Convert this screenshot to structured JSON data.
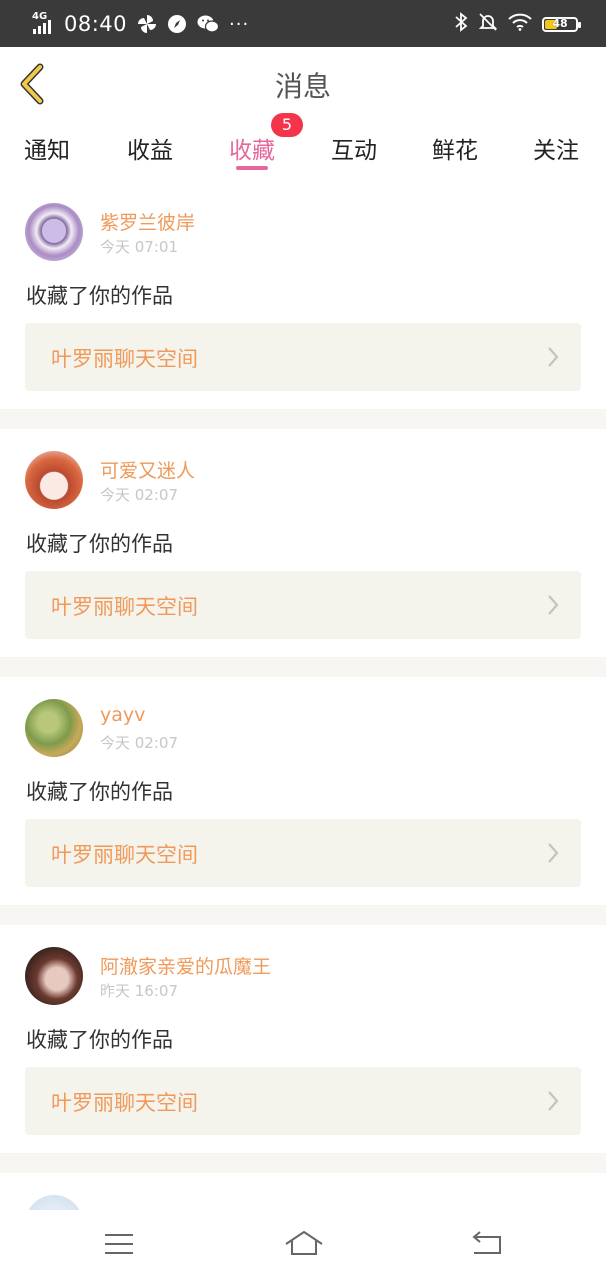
{
  "status_bar": {
    "network": "4G",
    "time": "08:40",
    "battery": "48",
    "battery_level": 0.48,
    "icons": [
      "signal-icon",
      "pinwheel-icon",
      "compass-icon",
      "wechat-icon",
      "more-dots-icon",
      "bluetooth-icon",
      "bell-muted-icon",
      "wifi-icon",
      "battery-icon"
    ]
  },
  "header": {
    "title": "消息",
    "back_icon": "chevron-left-icon"
  },
  "tabs": [
    {
      "label": "通知"
    },
    {
      "label": "收益"
    },
    {
      "label": "收藏",
      "active": true,
      "badge": "5"
    },
    {
      "label": "互动"
    },
    {
      "label": "鲜花"
    },
    {
      "label": "关注"
    }
  ],
  "colors": {
    "accent": "#e8679a",
    "username": "#ef9a5a",
    "badge": "#f3344a",
    "work_box": "#f4f4ed"
  },
  "messages": [
    {
      "username": "紫罗兰彼岸",
      "time": "今天 07:01",
      "action": "收藏了你的作品",
      "work": "叶罗丽聊天空间"
    },
    {
      "username": "可爱又迷人",
      "time": "今天 02:07",
      "action": "收藏了你的作品",
      "work": "叶罗丽聊天空间"
    },
    {
      "username": "yayv",
      "time": "今天 02:07",
      "action": "收藏了你的作品",
      "work": "叶罗丽聊天空间"
    },
    {
      "username": "阿澈家亲爱的瓜魔王",
      "time": "昨天 16:07",
      "action": "收藏了你的作品",
      "work": "叶罗丽聊天空间"
    }
  ],
  "nav": [
    "menu-icon",
    "home-icon",
    "back-icon"
  ]
}
